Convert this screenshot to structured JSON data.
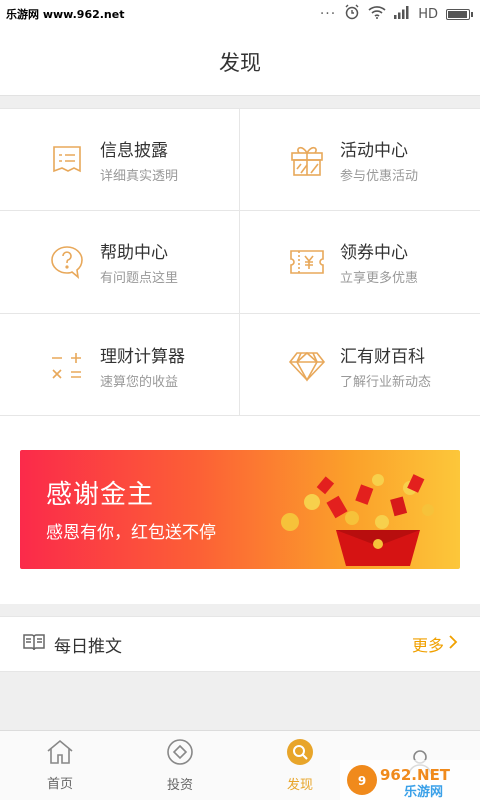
{
  "status_bar": {
    "watermark": "乐游网 www.962.net",
    "network": "HD",
    "battery_level": 0.85
  },
  "header": {
    "title": "发现"
  },
  "grid": [
    {
      "title": "信息披露",
      "subtitle": "详细真实透明",
      "icon": "document-list-icon"
    },
    {
      "title": "活动中心",
      "subtitle": "参与优惠活动",
      "icon": "gift-icon"
    },
    {
      "title": "帮助中心",
      "subtitle": "有问题点这里",
      "icon": "help-bubble-icon"
    },
    {
      "title": "领券中心",
      "subtitle": "立享更多优惠",
      "icon": "coupon-icon"
    },
    {
      "title": "理财计算器",
      "subtitle": "速算您的收益",
      "icon": "calculator-icon"
    },
    {
      "title": "汇有财百科",
      "subtitle": "了解行业新动态",
      "icon": "diamond-icon"
    }
  ],
  "banner": {
    "title": "感谢金主",
    "subtitle": "感恩有你，红包送不停"
  },
  "daily": {
    "label": "每日推文",
    "more": "更多"
  },
  "tabs": [
    {
      "label": "首页",
      "icon": "home-icon",
      "active": false
    },
    {
      "label": "投资",
      "icon": "invest-icon",
      "active": false
    },
    {
      "label": "发现",
      "icon": "discover-icon",
      "active": true
    },
    {
      "label": "",
      "icon": "account-icon",
      "active": false
    }
  ],
  "watermark_logo": "962.NET 乐游网",
  "colors": {
    "accent": "#e8a52a",
    "icon_stroke": "#e8a85a",
    "banner_start": "#fb2a4a",
    "banner_end": "#fcc73a"
  }
}
